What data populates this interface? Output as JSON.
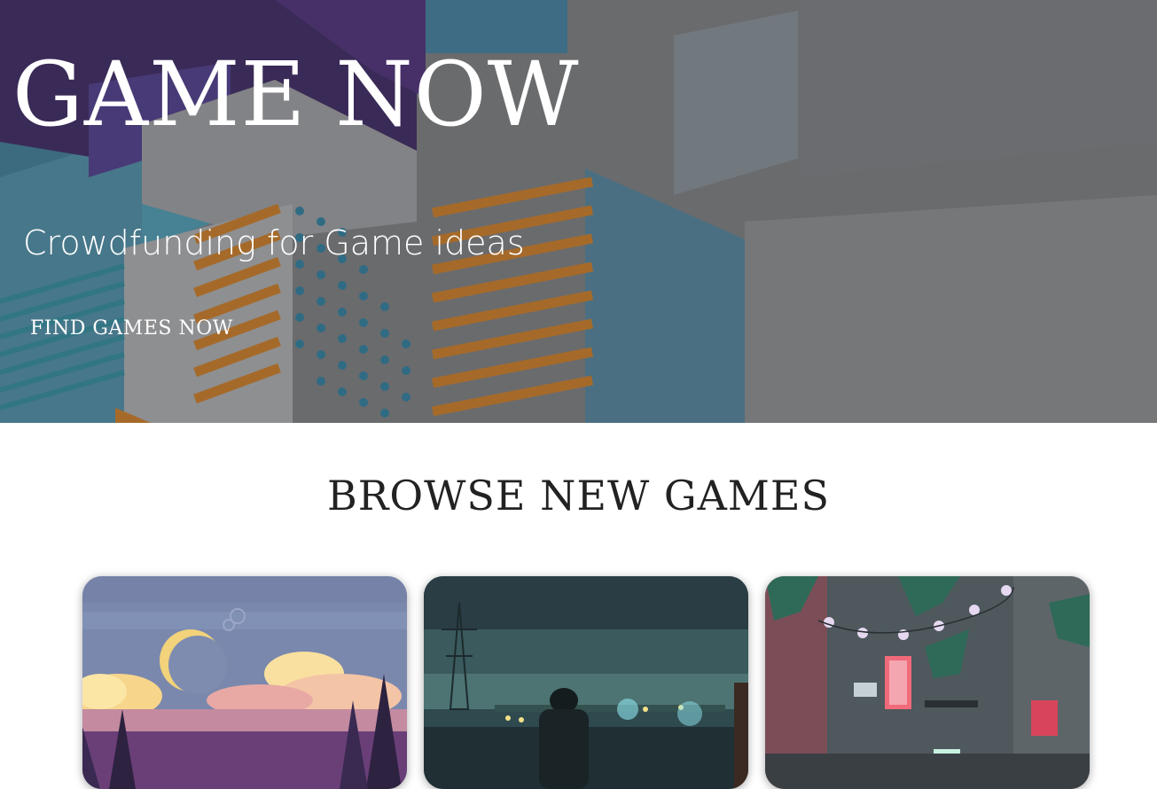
{
  "hero": {
    "title": "GAME NOW",
    "subtitle": "Crowdfunding for Game ideas",
    "cta_label": "FIND GAMES NOW"
  },
  "browse": {
    "heading": "BROWSE NEW GAMES",
    "cards": [
      {
        "image": "pixel-art-sunset-forest-image"
      },
      {
        "image": "pixel-art-night-city-figure-image"
      },
      {
        "image": "pixel-art-street-market-image"
      }
    ]
  },
  "colors": {
    "hero_overlay": "#5f6063",
    "purple": "#2a1550",
    "teal": "#1a6a8a",
    "orange": "#b96a14",
    "heading_text": "#222222"
  }
}
